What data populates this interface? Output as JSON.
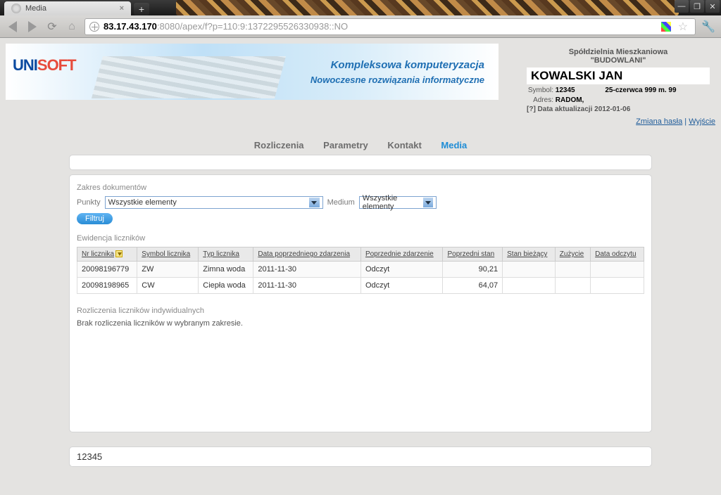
{
  "browser": {
    "tab_title": "Media",
    "url_host": "83.17.43.170",
    "url_rest": ":8080/apex/f?p=110:9:1372295526330938::NO"
  },
  "banner": {
    "logo1": "UNI",
    "logo2": "SOFT",
    "line1": "Kompleksowa komputeryzacja",
    "line2": "Nowoczesne rozwiązania informatyczne"
  },
  "user": {
    "coop1": "Spółdzielnia Mieszkaniowa",
    "coop2": "\"BUDOWLANI\"",
    "name": "KOWALSKI JAN",
    "symbol_label": "Symbol:",
    "symbol": "12345",
    "addr_label": "Adres:",
    "addr1": "RADOM,",
    "addr2": "25-czerwca 999 m. 99",
    "update_label": "[?] Data aktualizacji",
    "update_value": "2012-01-06",
    "change_pw": "Zmiana hasła",
    "logout": "Wyjście"
  },
  "nav": {
    "items": [
      "Rozliczenia",
      "Parametry",
      "Kontakt",
      "Media"
    ],
    "active": "Media"
  },
  "filters": {
    "section": "Zakres dokumentów",
    "punkty_label": "Punkty",
    "punkty_value": "Wszystkie elementy",
    "medium_label": "Medium",
    "medium_value": "Wszystkie elementy",
    "filter_btn": "Filtruj"
  },
  "meters": {
    "section": "Ewidencja liczników",
    "headers": {
      "nr": "Nr licznika",
      "sym": "Symbol licznika",
      "typ": "Typ licznika",
      "data_pop": "Data poprzedniego zdarzenia",
      "pop_zdarz": "Poprzednie zdarzenie",
      "pop_stan": "Poprzedni stan",
      "stan_biez": "Stan bieżący",
      "zuzycie": "Zużycie",
      "data_odcz": "Data odczytu"
    },
    "rows": [
      {
        "nr": "20098196779",
        "sym": "ZW",
        "typ": "Zimna woda",
        "data_pop": "2011-11-30",
        "pop_zdarz": "Odczyt",
        "pop_stan": "90,21",
        "stan_biez": "",
        "zuzycie": "",
        "data_odcz": ""
      },
      {
        "nr": "20098198965",
        "sym": "CW",
        "typ": "Ciepła woda",
        "data_pop": "2011-11-30",
        "pop_zdarz": "Odczyt",
        "pop_stan": "64,07",
        "stan_biez": "",
        "zuzycie": "",
        "data_odcz": ""
      }
    ]
  },
  "settlements": {
    "section": "Rozliczenia liczników indywidualnych",
    "no_data": "Brak rozliczenia liczników w wybranym zakresie."
  },
  "footer": {
    "text": "12345"
  }
}
